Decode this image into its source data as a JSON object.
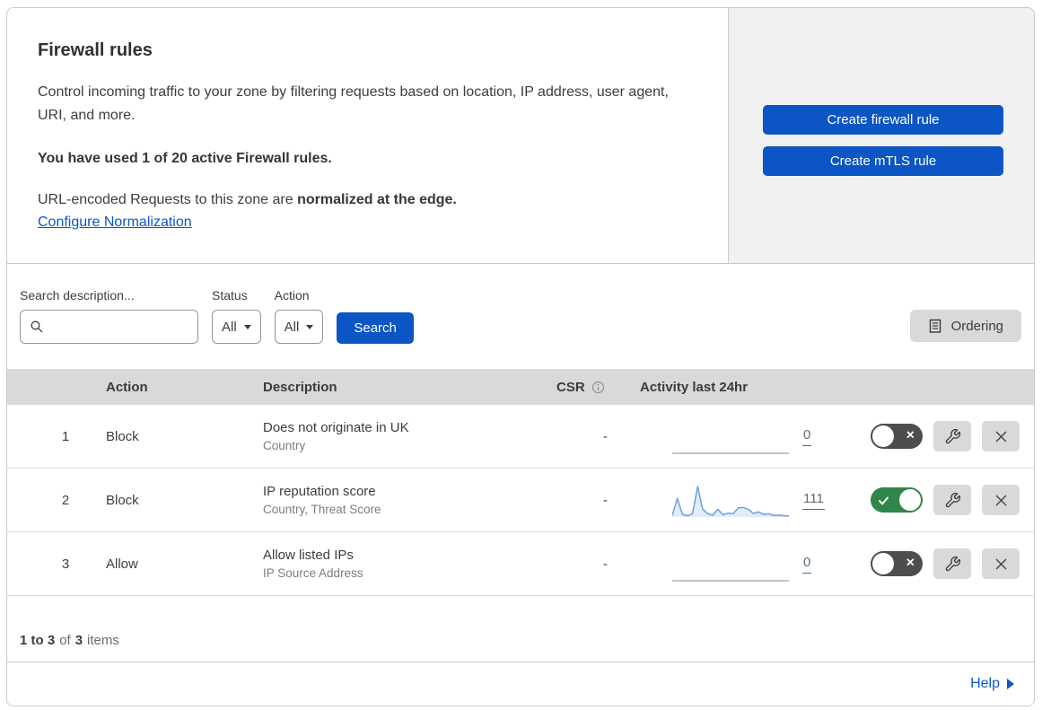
{
  "colors": {
    "accent_blue": "#0b55c4",
    "link_blue": "#0b57c8",
    "toggle_on_green": "#2e8648",
    "toggle_off_gray": "#4d4d4d",
    "sparkline_blue": "#6d9ee3",
    "table_header_gray": "#d9d9d9",
    "side_panel_gray": "#f1f1f1"
  },
  "icons": {
    "search": "magnifier-glyph",
    "ordering": "document-lines-glyph",
    "csr_info": "info-circle-glyph",
    "wrench": "wrench-glyph",
    "delete": "x-glyph",
    "toggle_on": "check-glyph",
    "toggle_off": "x-glyph",
    "dropdown_caret": "triangle-down",
    "help_arrow": "triangle-right"
  },
  "header": {
    "title": "Firewall rules",
    "description": "Control incoming traffic to your zone by filtering requests based on location, IP address, user agent, URI, and more.",
    "usage_text": "You have used 1 of 20 active Firewall rules.",
    "normalization_prefix": "URL-encoded Requests to this zone are ",
    "normalization_bold": "normalized at the edge.",
    "normalization_link": "Configure Normalization",
    "buttons": {
      "create_firewall": "Create firewall rule",
      "create_mtls": "Create mTLS rule"
    }
  },
  "filters": {
    "search_label": "Search description...",
    "search_value": "",
    "status": {
      "label": "Status",
      "value": "All"
    },
    "action": {
      "label": "Action",
      "value": "All"
    },
    "search_button": "Search",
    "ordering_button": "Ordering"
  },
  "table": {
    "headers": {
      "action": "Action",
      "description": "Description",
      "csr": "CSR",
      "activity": "Activity last 24hr"
    },
    "rows": [
      {
        "priority": "1",
        "action": "Block",
        "title": "Does not originate in UK",
        "fields": "Country",
        "csr": "-",
        "count": "0",
        "enabled": false
      },
      {
        "priority": "2",
        "action": "Block",
        "title": "IP reputation score",
        "fields": "Country, Threat Score",
        "csr": "-",
        "count": "111",
        "enabled": true
      },
      {
        "priority": "3",
        "action": "Allow",
        "title": "Allow listed IPs",
        "fields": "IP Source Address",
        "csr": "-",
        "count": "0",
        "enabled": false
      }
    ]
  },
  "chart_data": [
    {
      "type": "area",
      "name": "rule-1-activity-sparkline",
      "row_index": 0,
      "title": "Activity last 24hr",
      "total": 0,
      "values": [
        0,
        0,
        0,
        0,
        0,
        0,
        0,
        0,
        0,
        0,
        0,
        0,
        0,
        0,
        0,
        0,
        0,
        0,
        0,
        0,
        0,
        0,
        0,
        0
      ],
      "line_color": "#b0b0b0",
      "fill": false,
      "fill_color": "#e3ecf9"
    },
    {
      "type": "area",
      "name": "rule-2-activity-sparkline",
      "row_index": 1,
      "title": "Activity last 24hr",
      "total": 111,
      "values": [
        5,
        58,
        8,
        4,
        10,
        95,
        25,
        10,
        6,
        24,
        7,
        12,
        10,
        28,
        30,
        24,
        11,
        16,
        8,
        10,
        5,
        6,
        4,
        4
      ],
      "line_color": "#6d9ee3",
      "fill": true,
      "fill_color": "#e3ecf9"
    },
    {
      "type": "area",
      "name": "rule-3-activity-sparkline",
      "row_index": 2,
      "title": "Activity last 24hr",
      "total": 0,
      "values": [
        0,
        0,
        0,
        0,
        0,
        0,
        0,
        0,
        0,
        0,
        0,
        0,
        0,
        0,
        0,
        0,
        0,
        0,
        0,
        0,
        0,
        0,
        0,
        0
      ],
      "line_color": "#b0b0b0",
      "fill": false,
      "fill_color": "#e3ecf9"
    }
  ],
  "footer": {
    "range": "1 to 3",
    "of": "of",
    "total": "3",
    "items": "items"
  },
  "help": {
    "label": "Help"
  }
}
